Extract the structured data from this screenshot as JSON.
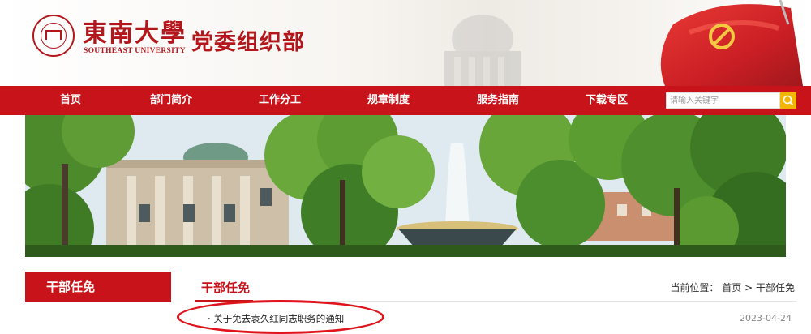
{
  "header": {
    "university_cn": "東南大學",
    "university_en": "SOUTHEAST UNIVERSITY",
    "department": "党委组织部"
  },
  "nav": {
    "items": [
      {
        "label": "首页"
      },
      {
        "label": "部门简介"
      },
      {
        "label": "工作分工"
      },
      {
        "label": "规章制度"
      },
      {
        "label": "服务指南"
      },
      {
        "label": "下载专区"
      }
    ],
    "search_placeholder": "请输入关键字",
    "accent": "#c8131a",
    "search_button_color": "#f2b705"
  },
  "sidebar": {
    "title": "干部任免"
  },
  "main": {
    "title": "干部任免",
    "breadcrumb": {
      "prefix": "当前位置：",
      "home": "首页",
      "separator": ">",
      "current": "干部任免"
    },
    "news": [
      {
        "title": "· 关于免去袁久红同志职务的通知",
        "date": "2023-04-24"
      }
    ]
  }
}
